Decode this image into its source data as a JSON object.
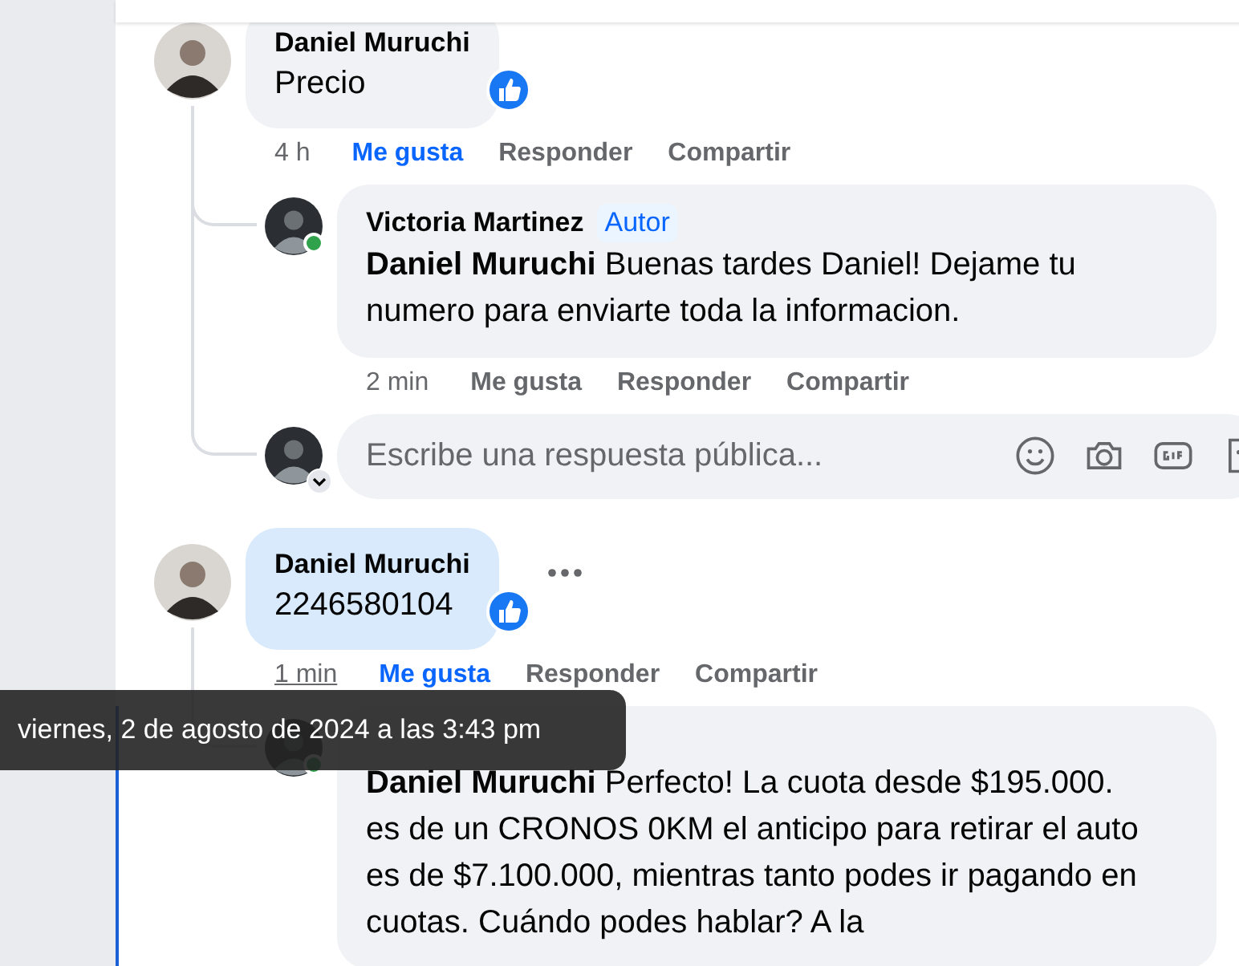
{
  "comments": [
    {
      "author": "Daniel Muruchi",
      "text": "Precio",
      "highlighted": false,
      "liked": true,
      "more_menu": false,
      "time": "4 h",
      "time_hovered": false,
      "actions": [
        {
          "label": "Me gusta",
          "active": true
        },
        {
          "label": "Responder",
          "active": false
        },
        {
          "label": "Compartir",
          "active": false
        }
      ],
      "replies": [
        {
          "kind": "reply",
          "author": "Victoria Martinez",
          "online": true,
          "badge": "Autor",
          "text": "**Daniel Muruchi** Buenas tardes Daniel! Dejame tu numero para enviarte toda la informacion.",
          "time": "2 min",
          "time_hovered": false,
          "actions": [
            {
              "label": "Me gusta",
              "active": false
            },
            {
              "label": "Responder",
              "active": false
            },
            {
              "label": "Compartir",
              "active": false
            }
          ]
        },
        {
          "kind": "composer",
          "placeholder": "Escribe una respuesta pública..."
        }
      ]
    },
    {
      "author": "Daniel Muruchi",
      "text": "2246580104",
      "highlighted": true,
      "liked": true,
      "more_menu": true,
      "time": "1 min",
      "time_hovered": true,
      "actions": [
        {
          "label": "Me gusta",
          "active": true
        },
        {
          "label": "Responder",
          "active": false
        },
        {
          "label": "Compartir",
          "active": false
        }
      ],
      "replies": [
        {
          "kind": "reply",
          "online": true,
          "text": "**Daniel Muruchi** Perfecto! La cuota desde $195.000. es de un CRONOS 0KM el anticipo para retirar el auto es de $7.100.000, mientras tanto podes ir pagando en cuotas. Cuándo podes hablar? A la"
        }
      ]
    }
  ],
  "tooltip": {
    "text": "viernes, 2 de agosto de 2024 a las 3:43 pm"
  }
}
